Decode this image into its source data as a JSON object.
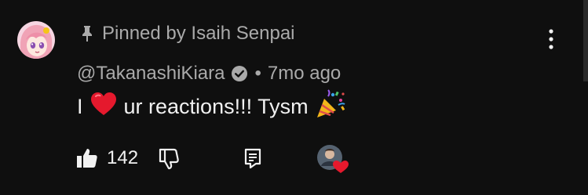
{
  "comment": {
    "pinned_label": "Pinned by Isaih Senpai",
    "author": "@TakanashiKiara",
    "separator": "•",
    "timestamp": "7mo ago",
    "text_before_heart": "I",
    "text_after_heart": "ur reactions!!! Tysm",
    "like_count": "142"
  },
  "icons": {
    "pin": "pin-icon",
    "verified": "verified-check-icon",
    "heart_emoji": "red-heart-emoji",
    "party_emoji": "party-popper-emoji",
    "like": "thumbs-up-icon",
    "dislike": "thumbs-down-icon",
    "reply": "reply-comment-icon",
    "menu": "more-vertical-icon",
    "creator_heart": "creator-heart-badge"
  },
  "colors": {
    "background": "#0f0f0f",
    "primary_text": "#f1f1f1",
    "secondary_text": "#aaaaaa",
    "heart": "#e0245e"
  }
}
